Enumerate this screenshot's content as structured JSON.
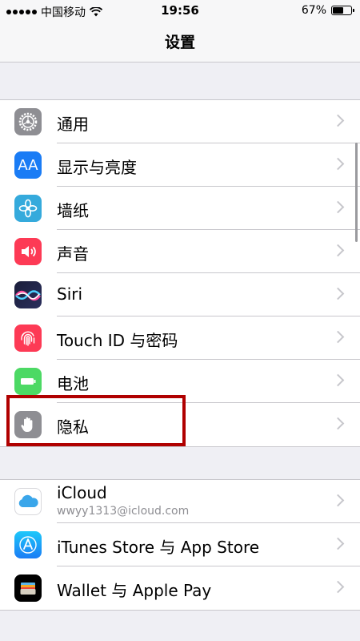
{
  "status_bar": {
    "carrier": "中国移动",
    "time": "19:56",
    "battery": "67%",
    "battery_level": 0.67
  },
  "nav": {
    "title": "设置"
  },
  "groups": [
    {
      "items": [
        {
          "label": "通用",
          "icon": "gear-icon",
          "color": "#8e8e93"
        },
        {
          "label": "显示与亮度",
          "icon": "aa-icon",
          "icon_text": "AA",
          "color": "#1a7cf5"
        },
        {
          "label": "墙纸",
          "icon": "flower-icon",
          "color": "#35aadc"
        },
        {
          "label": "声音",
          "icon": "speaker-icon",
          "color": "#fd3a55"
        },
        {
          "label": "Siri",
          "icon": "siri-icon",
          "color": "#1b1e3a"
        },
        {
          "label": "Touch ID 与密码",
          "icon": "fingerprint-icon",
          "color": "#fd3a55"
        },
        {
          "label": "电池",
          "icon": "battery-icon",
          "color": "#4cd964"
        },
        {
          "label": "隐私",
          "icon": "hand-icon",
          "color": "#8e8e93"
        }
      ]
    },
    {
      "items": [
        {
          "label": "iCloud",
          "sublabel": "wwyy1313@icloud.com",
          "icon": "cloud-icon",
          "color": "#ffffff"
        },
        {
          "label": "iTunes Store 与 App Store",
          "icon": "appstore-icon",
          "color": "#1a8cf5"
        },
        {
          "label": "Wallet 与 Apple Pay",
          "icon": "wallet-icon",
          "color": "#000000"
        }
      ]
    }
  ]
}
